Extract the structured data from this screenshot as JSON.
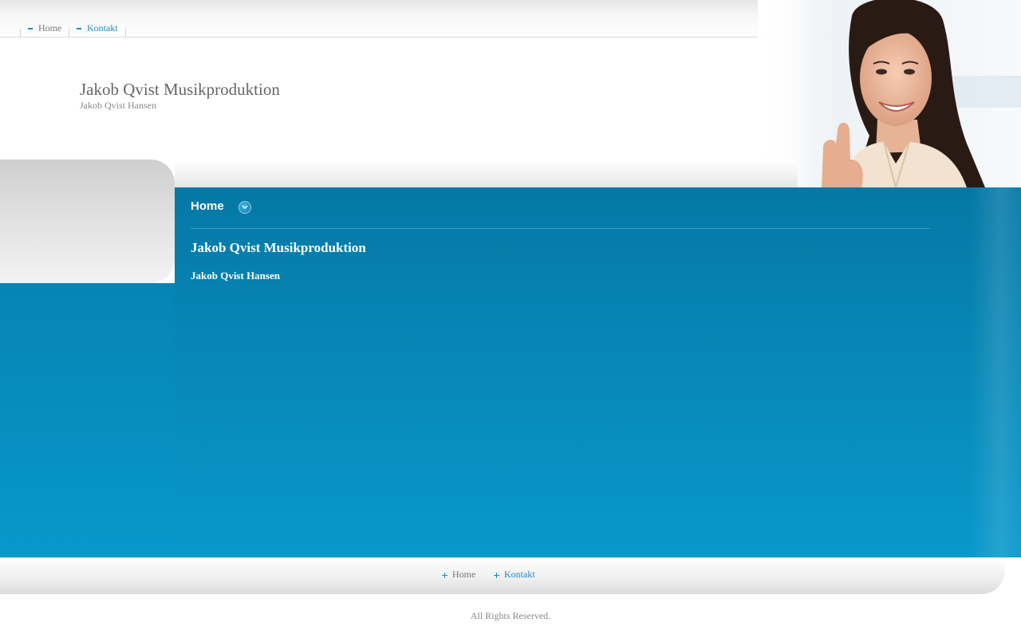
{
  "top_nav": {
    "items": [
      {
        "label": "Home"
      },
      {
        "label": "Kontakt"
      }
    ]
  },
  "header": {
    "site_title": "Jakob Qvist Musikproduktion",
    "site_subtitle": "Jakob Qvist Hansen"
  },
  "main": {
    "page_heading": "Home",
    "content_title": "Jakob Qvist Musikproduktion",
    "content_subtitle": "Jakob Qvist Hansen"
  },
  "footer": {
    "nav": [
      {
        "label": "Home"
      },
      {
        "label": "Kontakt"
      }
    ],
    "copyright": "All Rights Reserved."
  },
  "colors": {
    "accent": "#1a8fc0",
    "panel_blue": "#0787b6"
  },
  "icons": {
    "top_nav_marker": "dash-icon",
    "heading_toggle": "chevron-down-icon",
    "footer_nav_marker": "plus-icon"
  }
}
